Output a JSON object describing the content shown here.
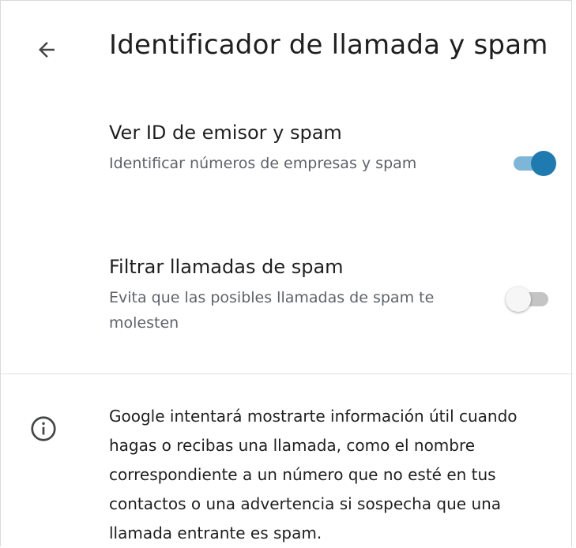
{
  "header": {
    "title": "Identificador de llamada y spam",
    "back_icon": "arrow-back-icon"
  },
  "settings": [
    {
      "title": "Ver ID de emisor y spam",
      "description": "Identificar números de empresas y spam",
      "enabled": true
    },
    {
      "title": "Filtrar llamadas de spam",
      "description": "Evita que las posibles llamadas de spam te molesten",
      "enabled": false
    }
  ],
  "info": {
    "icon": "info-icon",
    "text": "Google intentará mostrarte información útil cuando hagas o recibas una llamada, como el nombre correspondiente a un número que no esté en tus contactos o una advertencia si sospecha que una llamada entrante es spam."
  },
  "colors": {
    "toggle_on_thumb": "#1f7ab0",
    "toggle_on_track": "#7db6d6",
    "toggle_off_thumb": "#f6f6f6",
    "toggle_off_track": "#c4c4c4"
  }
}
